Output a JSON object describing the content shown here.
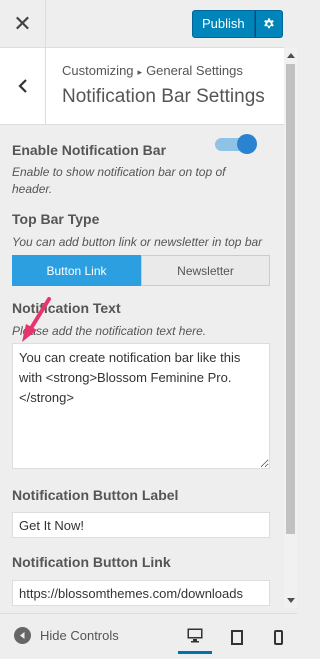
{
  "header": {
    "close_icon": "close-icon",
    "publish_label": "Publish",
    "settings_icon": "gear-icon"
  },
  "section": {
    "breadcrumb_root": "Customizing",
    "breadcrumb_parent": "General Settings",
    "title": "Notification Bar Settings"
  },
  "controls": {
    "enable": {
      "label": "Enable Notification Bar",
      "description": "Enable to show notification bar on top of header.",
      "value": true
    },
    "top_bar_type": {
      "label": "Top Bar Type",
      "description": "You can add button link or newsletter in top bar",
      "options": [
        "Button Link",
        "Newsletter"
      ],
      "selected": "Button Link"
    },
    "notification_text": {
      "label": "Notification Text",
      "description": "Please add the notification text here.",
      "value": "You can create notification bar like this with <strong>Blossom Feminine Pro.</strong>"
    },
    "button_label": {
      "label": "Notification Button Label",
      "value": "Get It Now!"
    },
    "button_link": {
      "label": "Notification Button Link",
      "value": "https://blossomthemes.com/downloads"
    }
  },
  "footer": {
    "hide_controls_label": "Hide Controls",
    "devices": [
      "desktop-icon",
      "tablet-icon",
      "mobile-icon"
    ],
    "active_device": "desktop-icon"
  },
  "colors": {
    "accent": "#0085ba",
    "toggle_on": "#2a83d0",
    "segment_active": "#2c9fe0",
    "annotation_arrow": "#e8336d"
  }
}
